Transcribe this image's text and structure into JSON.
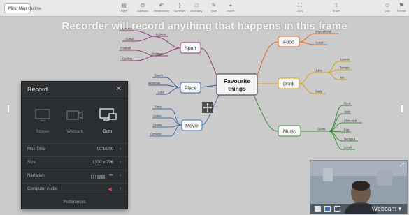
{
  "toolbar": {
    "tabs": [
      {
        "label": "Mind Map",
        "active": true
      },
      {
        "label": "Outline",
        "active": false
      }
    ],
    "tools": [
      {
        "name": "style-tool",
        "label": "Style",
        "icon": "style-icon"
      },
      {
        "name": "subtopic-tool",
        "label": "Subtopic",
        "icon": "subtopic-icon"
      },
      {
        "name": "relationship-tool",
        "label": "Relationship",
        "icon": "relationship-icon"
      },
      {
        "name": "summary-tool",
        "label": "Summary",
        "icon": "summary-icon"
      },
      {
        "name": "boundary-tool",
        "label": "Boundary",
        "icon": "boundary-icon"
      },
      {
        "name": "note-tool",
        "label": "Note",
        "icon": "note-icon"
      },
      {
        "name": "insert-tool",
        "label": "Insert",
        "icon": "insert-icon"
      },
      {
        "name": "zen-tool",
        "label": "ZEN",
        "icon": "zen-icon"
      },
      {
        "name": "share-tool",
        "label": "Share",
        "icon": "share-icon"
      },
      {
        "name": "icon-tool",
        "label": "Icon",
        "icon": "icon-icon"
      },
      {
        "name": "format-tool",
        "label": "Format",
        "icon": "format-icon"
      }
    ]
  },
  "banner": "Recorder will record anything that happens in this frame",
  "mindmap": {
    "central": [
      "Favourite",
      "things"
    ],
    "sport": {
      "label": "Sport",
      "leaves": [
        "Indoors",
        "Outdoors"
      ],
      "indoors": [
        "Badminton",
        "Futsal"
      ],
      "outdoors": [
        "Football",
        "Cycling"
      ]
    },
    "place": {
      "label": "Place",
      "leaves": [
        "Beach",
        "Mountain",
        "Lake"
      ]
    },
    "movie": {
      "label": "Movie",
      "leaves": [
        "Story",
        "Action",
        "Drama",
        "Comedy"
      ]
    },
    "food": {
      "label": "Food",
      "leaves": [
        "International",
        "Local"
      ]
    },
    "drink": {
      "label": "Drink",
      "leaves": [
        "Juice",
        "Soda"
      ],
      "juice": [
        "Lemon",
        "Tomato",
        "etc"
      ]
    },
    "music": {
      "label": "Music",
      "leaves": [
        "Genre"
      ],
      "genre": [
        "Rock",
        "Jazz",
        "Slow-rock",
        "Pop",
        "Dangdut",
        "Locals"
      ]
    },
    "colors": {
      "sport": "#8e3f7c",
      "place": "#3c5a99",
      "movie": "#3f6fb0",
      "food": "#d9681e",
      "drink": "#d6a21a",
      "music": "#3d8f3d"
    }
  },
  "record_panel": {
    "title": "Record",
    "close_icon": "close-icon",
    "modes": [
      {
        "label": "Screen",
        "icon": "screen-icon",
        "selected": false
      },
      {
        "label": "Webcam",
        "icon": "webcam-icon",
        "selected": false
      },
      {
        "label": "Both",
        "icon": "both-icon",
        "selected": true
      }
    ],
    "rows": [
      {
        "key": "Max Time",
        "value": "00:15:00"
      },
      {
        "key": "Size",
        "value": "1330 x 706"
      },
      {
        "key": "Narration",
        "value": ""
      },
      {
        "key": "Computer Audio",
        "value": ""
      }
    ],
    "preferences": "Preferences"
  },
  "webcam": {
    "label": "Webcam"
  }
}
